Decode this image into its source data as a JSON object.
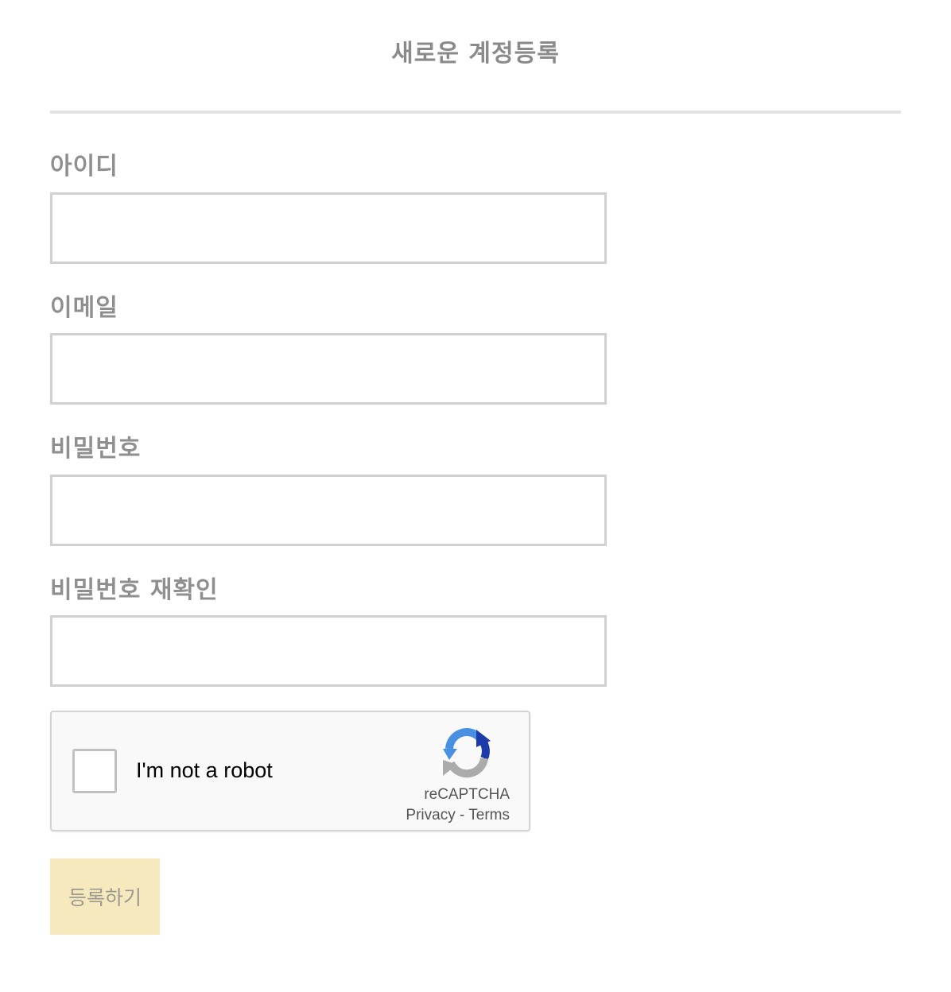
{
  "header": {
    "title": "새로운 계정등록"
  },
  "form": {
    "fields": [
      {
        "label": "아이디",
        "value": "",
        "placeholder": ""
      },
      {
        "label": "이메일",
        "value": "",
        "placeholder": ""
      },
      {
        "label": "비밀번호",
        "value": "",
        "placeholder": ""
      },
      {
        "label": "비밀번호 재확인",
        "value": "",
        "placeholder": ""
      }
    ],
    "submit_label": "등록하기"
  },
  "recaptcha": {
    "label": "I'm not a robot",
    "brand": "reCAPTCHA",
    "privacy_label": "Privacy",
    "separator": " - ",
    "terms_label": "Terms",
    "checked": false,
    "icon": "recaptcha-logo-icon"
  },
  "colors": {
    "title": "#8a8a8a",
    "label": "#8f8f8f",
    "input_border": "#d0d0d0",
    "divider": "#e2e2e2",
    "submit_bg": "#f6e9bd",
    "submit_text": "#9c9a90",
    "recaptcha_bg": "#f9f9f9"
  }
}
